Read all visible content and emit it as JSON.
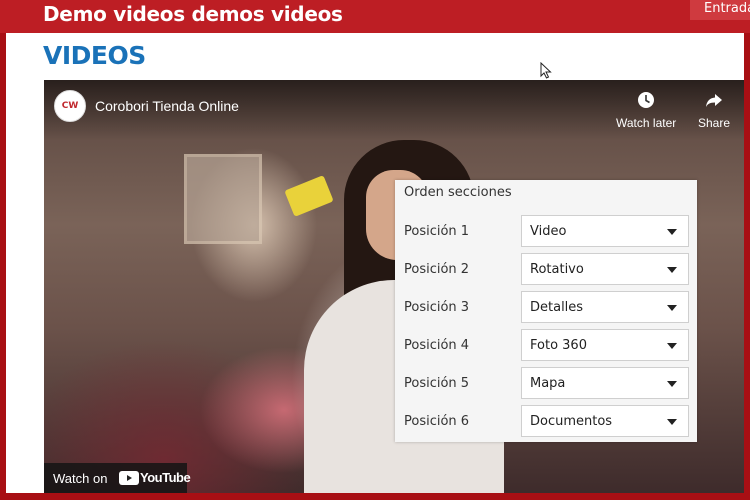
{
  "header": {
    "title": "Demo videos demos videos",
    "login_label": "Entrada"
  },
  "page": {
    "heading": "VIDEOS"
  },
  "video": {
    "channel_avatar_text": "CW",
    "channel_name": "Corobori Tienda Online",
    "watch_later_label": "Watch later",
    "share_label": "Share",
    "watch_on_label": "Watch on",
    "youtube_label": "YouTube"
  },
  "panel": {
    "title": "Orden secciones",
    "rows": [
      {
        "label": "Posición 1",
        "value": "Video"
      },
      {
        "label": "Posición 2",
        "value": "Rotativo"
      },
      {
        "label": "Posición 3",
        "value": "Detalles"
      },
      {
        "label": "Posición 4",
        "value": "Foto 360"
      },
      {
        "label": "Posición 5",
        "value": "Mapa"
      },
      {
        "label": "Posición 6",
        "value": "Documentos"
      }
    ]
  },
  "colors": {
    "brand_red": "#bd1e24",
    "heading_blue": "#1a72b8"
  },
  "icons": [
    "clock-icon",
    "share-icon",
    "youtube-logo-icon",
    "chevron-down-icon",
    "mouse-cursor-icon"
  ]
}
